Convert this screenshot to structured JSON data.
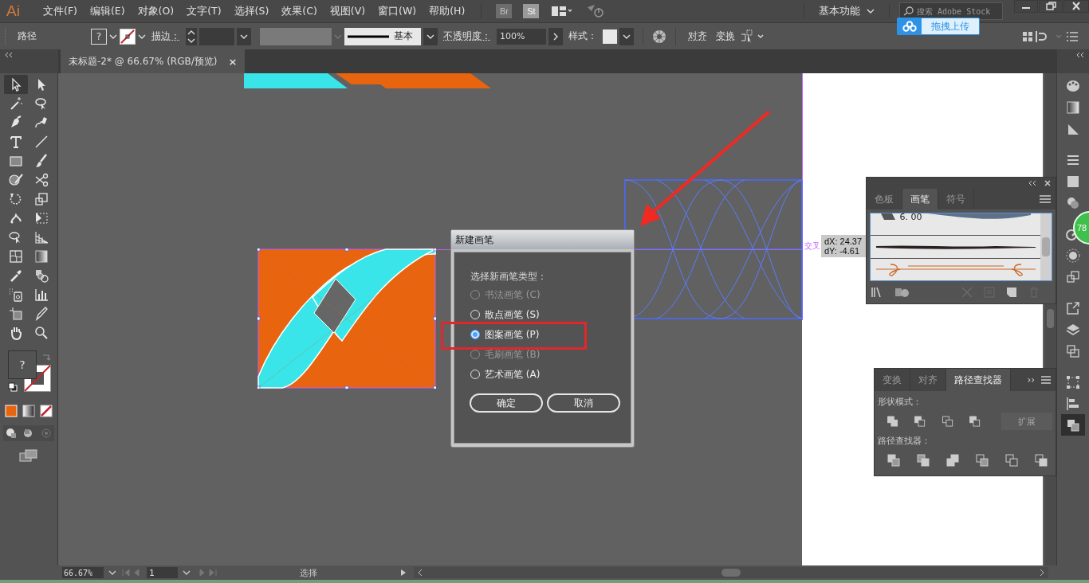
{
  "menu_bar": {
    "logo": "Ai",
    "items": [
      "文件(F)",
      "编辑(E)",
      "对象(O)",
      "文字(T)",
      "选择(S)",
      "效果(C)",
      "视图(V)",
      "窗口(W)",
      "帮助(H)"
    ],
    "bridge": "Br",
    "stock": "St",
    "workspace": "基本功能",
    "search": {
      "placeholder": "搜索 Adobe Stock"
    }
  },
  "upload_badge": "拖拽上传",
  "control_bar": {
    "selection": "路径",
    "fill_swatch": "?",
    "stroke_label": "描边：",
    "brush_profile": "基本",
    "opacity_label": "不透明度：",
    "opacity": "100%",
    "style_label": "样式：",
    "align": "对齐",
    "transform": "变换"
  },
  "document_tab": {
    "title": "未标题-2* @ 66.67% (RGB/预览)",
    "close": "×"
  },
  "tools": [
    {
      "kind": "outline-arrow",
      "selected": true
    },
    {
      "kind": "solid-arrow",
      "selected": false
    },
    {
      "kind": "wand",
      "selected": false
    },
    {
      "kind": "lasso",
      "selected": false
    },
    {
      "kind": "pen",
      "selected": false
    },
    {
      "kind": "curve-pen",
      "selected": false
    },
    {
      "kind": "type",
      "selected": false
    },
    {
      "kind": "line",
      "selected": false
    },
    {
      "kind": "rectangle",
      "selected": false
    },
    {
      "kind": "brush",
      "selected": false
    },
    {
      "kind": "blob",
      "selected": false
    },
    {
      "kind": "scissors",
      "selected": false
    },
    {
      "kind": "rotate",
      "selected": false
    },
    {
      "kind": "scale",
      "selected": false
    },
    {
      "kind": "puppet",
      "selected": false
    },
    {
      "kind": "free-transform",
      "selected": false
    },
    {
      "kind": "shape-builder",
      "selected": false
    },
    {
      "kind": "perspective",
      "selected": false
    },
    {
      "kind": "mesh",
      "selected": false
    },
    {
      "kind": "gradient",
      "selected": false
    },
    {
      "kind": "eyedropper",
      "selected": false
    },
    {
      "kind": "blend",
      "selected": false
    },
    {
      "kind": "sprayer",
      "selected": false
    },
    {
      "kind": "bar-chart",
      "selected": false
    },
    {
      "kind": "artboard",
      "selected": false
    },
    {
      "kind": "knife",
      "selected": false
    },
    {
      "kind": "hand",
      "selected": false
    },
    {
      "kind": "zoom",
      "selected": false
    }
  ],
  "fill_stroke": {
    "fill_swatch": "?"
  },
  "canvas": {
    "smart_guide": "交叉",
    "tooltip": [
      "dX: 24.37",
      "dY: -4.61"
    ]
  },
  "dialog": {
    "title": "新建画笔",
    "prompt": "选择新画笔类型：",
    "options": [
      {
        "label": "书法画笔 (C)",
        "selected": false,
        "disabled": true
      },
      {
        "label": "散点画笔 (S)",
        "selected": false,
        "disabled": false
      },
      {
        "label": "图案画笔 (P)",
        "selected": true,
        "disabled": false
      },
      {
        "label": "毛刷画笔 (B)",
        "selected": false,
        "disabled": true
      },
      {
        "label": "艺术画笔 (A)",
        "selected": false,
        "disabled": false
      }
    ],
    "buttons": [
      "确定",
      "取消"
    ]
  },
  "brushes_panel": {
    "tabs": [
      {
        "label": "色板",
        "selected": false
      },
      {
        "label": "画笔",
        "selected": true
      },
      {
        "label": "符号",
        "selected": false
      }
    ],
    "size_label": "6. 00"
  },
  "pathfinder_panel": {
    "tabs": [
      {
        "label": "变换",
        "selected": false
      },
      {
        "label": "对齐",
        "selected": false
      },
      {
        "label": "路径查找器",
        "selected": true
      }
    ],
    "more": "››",
    "shape_modes_label": "形状模式：",
    "expand": "扩展",
    "pathfinders_label": "路径查找器："
  },
  "dock": [
    {
      "kind": "palette",
      "selected": false
    },
    {
      "kind": "gradient",
      "selected": false
    },
    {
      "kind": "transparency",
      "selected": false
    },
    {
      "kind": "stroke",
      "selected": false
    },
    {
      "kind": "swatch",
      "selected": false
    },
    {
      "kind": "circles",
      "selected": false
    },
    {
      "kind": "brush-circle",
      "selected": false
    },
    {
      "kind": "sun",
      "selected": false
    },
    {
      "kind": "symbol",
      "selected": false
    },
    {
      "kind": "export",
      "selected": false
    },
    {
      "kind": "layers",
      "selected": false
    },
    {
      "kind": "artboards",
      "selected": false
    },
    {
      "kind": "transform",
      "selected": false
    },
    {
      "kind": "align",
      "selected": false
    },
    {
      "kind": "pathfinder",
      "selected": true
    }
  ],
  "score_badge": "78",
  "status_bar": {
    "zoom": "66.67%",
    "page": "1",
    "tool": "选择"
  }
}
